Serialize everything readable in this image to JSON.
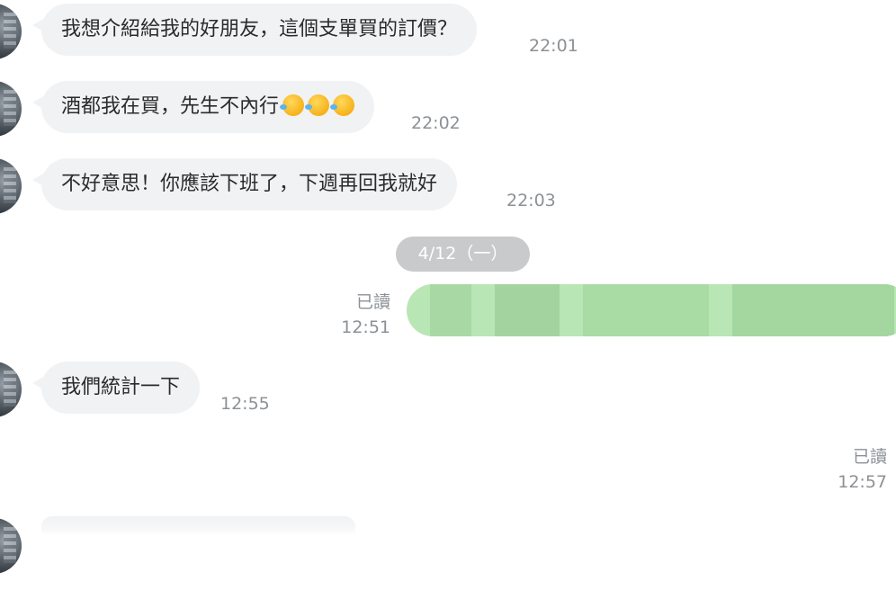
{
  "messages": [
    {
      "text": "我想介紹給我的好朋友，這個支單買的訂價？",
      "time": "22:01",
      "avatar": "contact-avatar"
    },
    {
      "text": "酒都我在買，先生不內行",
      "emoji_name": "rolling-on-floor-laughing-emoji",
      "emoji_count": 3,
      "time": "22:02",
      "avatar": "contact-avatar"
    },
    {
      "text": "不好意思！你應該下班了，下週再回我就好",
      "time": "22:03",
      "avatar": "contact-avatar"
    }
  ],
  "date_divider": "4/12（一）",
  "outgoing_1": {
    "read": "已讀",
    "time": "12:51",
    "redacted": true
  },
  "message_4": {
    "text": "我們統計一下",
    "time": "12:55"
  },
  "outgoing_2": {
    "read": "已讀",
    "time": "12:57"
  },
  "colors": {
    "incoming_bubble": "#f1f2f4",
    "outgoing_bubble": "#b9e6b5",
    "timestamp": "#8c9196",
    "date_chip": "#c8cacc"
  }
}
